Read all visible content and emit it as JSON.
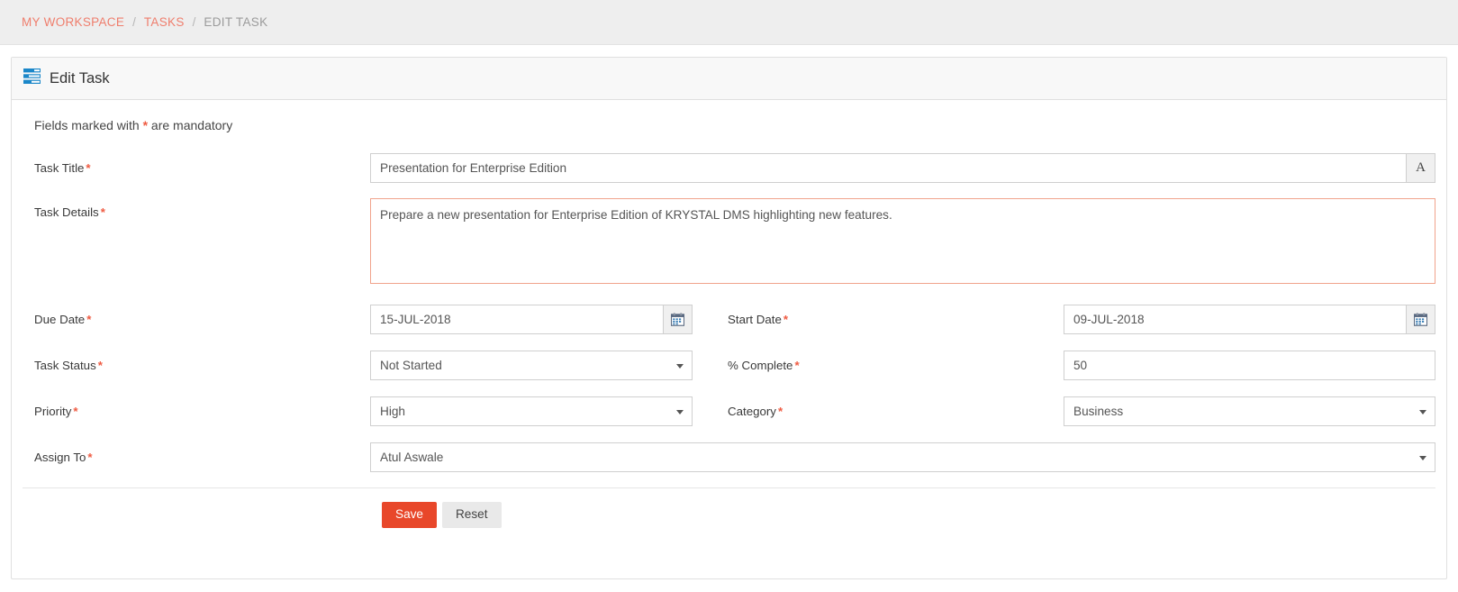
{
  "breadcrumb": {
    "items": [
      {
        "label": "MY WORKSPACE",
        "current": false
      },
      {
        "label": "TASKS",
        "current": false
      },
      {
        "label": "EDIT TASK",
        "current": true
      }
    ],
    "separator": "/"
  },
  "panel": {
    "title": "Edit Task",
    "icon": "task-list-icon"
  },
  "form": {
    "mandatory_note_pre": "Fields marked with ",
    "mandatory_star": "*",
    "mandatory_note_post": " are mandatory",
    "task_title": {
      "label": "Task Title",
      "required_star": "*",
      "value": "Presentation for Enterprise Edition",
      "placeholder": "Task Title",
      "addon_label": "A",
      "addon_icon": "font-style-icon"
    },
    "task_details": {
      "label": "Task Details",
      "required_star": "*",
      "value": "Prepare a new presentation for Enterprise Edition of KRYSTAL DMS highlighting new features.",
      "placeholder": "Task Details"
    },
    "due_date": {
      "label": "Due Date",
      "required_star": "*",
      "value": "15-JUL-2018",
      "placeholder": "Due Date",
      "addon_icon": "calendar-icon"
    },
    "start_date": {
      "label": "Start Date",
      "required_star": "*",
      "value": "09-JUL-2018",
      "placeholder": "Start Date",
      "addon_icon": "calendar-icon"
    },
    "task_status": {
      "label": "Task Status",
      "required_star": "*",
      "value": "Not Started"
    },
    "percent_complete": {
      "label": "% Complete",
      "required_star": "*",
      "value": "50",
      "placeholder": "% Complete"
    },
    "priority": {
      "label": "Priority",
      "required_star": "*",
      "value": "High"
    },
    "category": {
      "label": "Category",
      "required_star": "*",
      "value": "Business"
    },
    "assign_to": {
      "label": "Assign To",
      "required_star": "*",
      "value": "Atul Aswale"
    },
    "buttons": {
      "save": "Save",
      "reset": "Reset"
    }
  },
  "colors": {
    "breadcrumb_link": "#ef7e6d",
    "breadcrumb_current": "#9b9b9b",
    "required_star": "#ef5b42",
    "save_button": "#e8472a",
    "reset_button": "#e9e9e9",
    "focus_border": "#f0a38c",
    "icon_blue": "#1b87c9"
  }
}
